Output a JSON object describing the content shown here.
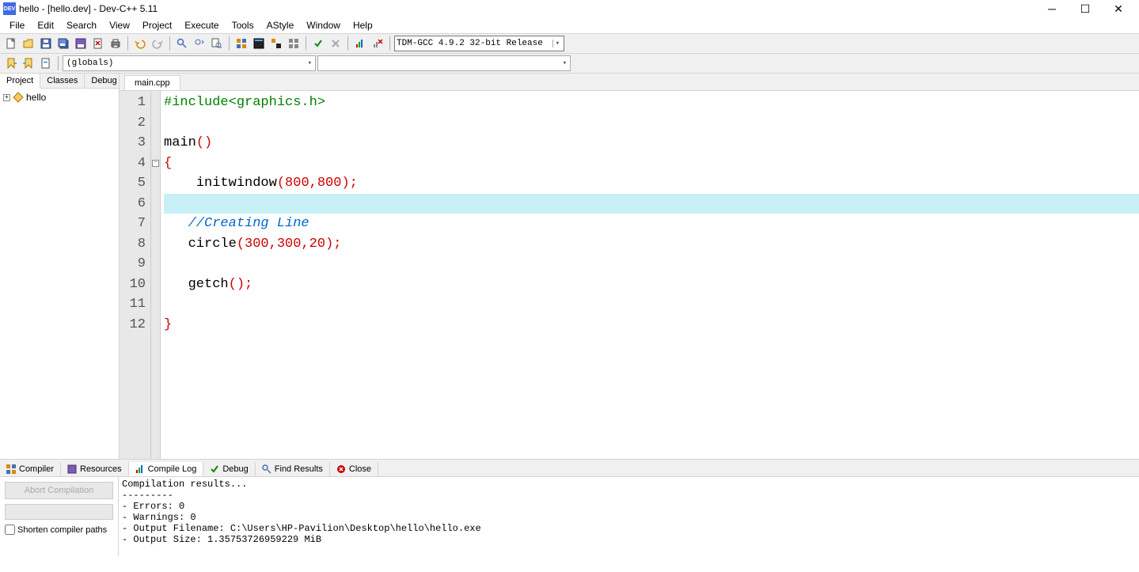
{
  "title": "hello - [hello.dev] - Dev-C++ 5.11",
  "app_icon_text": "DEV",
  "menu": [
    "File",
    "Edit",
    "Search",
    "View",
    "Project",
    "Execute",
    "Tools",
    "AStyle",
    "Window",
    "Help"
  ],
  "compiler_profile": "TDM-GCC 4.9.2 32-bit Release",
  "globals_label": "(globals)",
  "sidebar_tabs": [
    "Project",
    "Classes",
    "Debug"
  ],
  "active_sidebar_tab": 0,
  "project_name": "hello",
  "editor_tab": "main.cpp",
  "code_lines": [
    {
      "n": 1,
      "html": "<span class='kw-preproc'>#include&lt;graphics.h&gt;</span>"
    },
    {
      "n": 2,
      "html": ""
    },
    {
      "n": 3,
      "html": "<span class='kw-main'>main</span><span class='paren'>()</span>"
    },
    {
      "n": 4,
      "html": "<span class='brace'>{</span>",
      "fold": "minus"
    },
    {
      "n": 5,
      "html": "    <span class='str-ident'>initwindow</span><span class='paren'>(</span><span class='number'>800</span><span class='paren'>,</span><span class='number'>800</span><span class='paren'>)</span><span class='semi'>;</span>"
    },
    {
      "n": 6,
      "html": "    ",
      "hl": true
    },
    {
      "n": 7,
      "html": "   <span class='comment'>//Creating Line</span>"
    },
    {
      "n": 8,
      "html": "   <span class='str-ident'>circle</span><span class='paren'>(</span><span class='number'>300</span><span class='paren'>,</span><span class='number'>300</span><span class='paren'>,</span><span class='number'>20</span><span class='paren'>)</span><span class='semi'>;</span>"
    },
    {
      "n": 9,
      "html": ""
    },
    {
      "n": 10,
      "html": "   <span class='str-ident'>getch</span><span class='paren'>()</span><span class='semi'>;</span>"
    },
    {
      "n": 11,
      "html": ""
    },
    {
      "n": 12,
      "html": "<span class='brace'>}</span>"
    }
  ],
  "bottom_tabs": [
    {
      "label": "Compiler",
      "icon": "grid"
    },
    {
      "label": "Resources",
      "icon": "resources"
    },
    {
      "label": "Compile Log",
      "icon": "chart",
      "active": true
    },
    {
      "label": "Debug",
      "icon": "check"
    },
    {
      "label": "Find Results",
      "icon": "search"
    },
    {
      "label": "Close",
      "icon": "close"
    }
  ],
  "abort_label": "Abort Compilation",
  "shorten_label": "Shorten compiler paths",
  "compile_log": "Compilation results...\n---------\n- Errors: 0\n- Warnings: 0\n- Output Filename: C:\\Users\\HP-Pavilion\\Desktop\\hello\\hello.exe\n- Output Size: 1.35753726959229 MiB"
}
